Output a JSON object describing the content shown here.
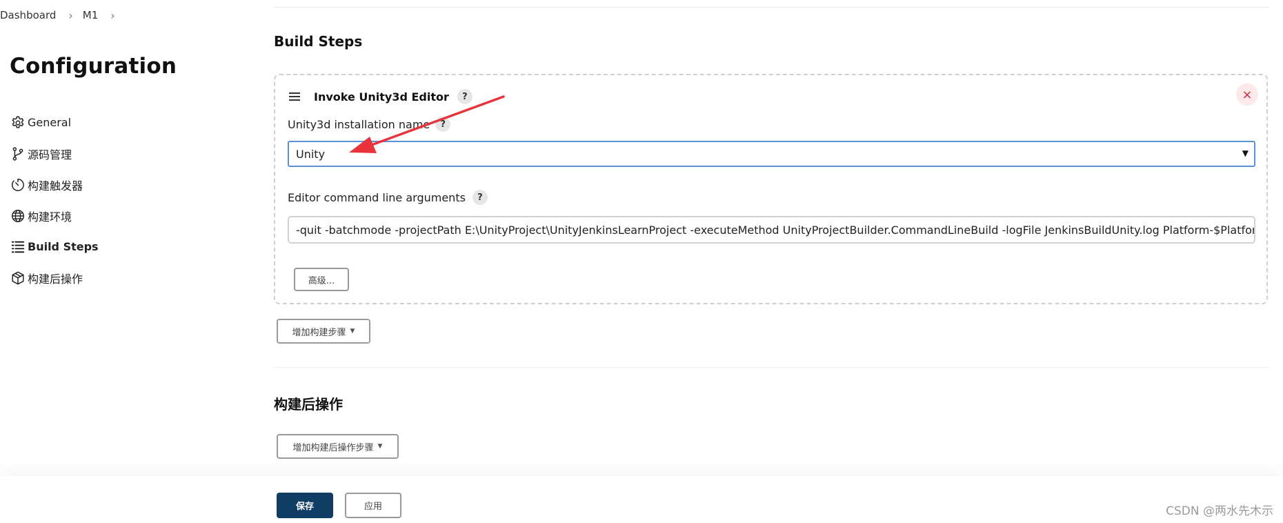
{
  "breadcrumb": {
    "items": [
      "Dashboard",
      "M1"
    ]
  },
  "page": {
    "title": "Configuration"
  },
  "sidebar": {
    "items": [
      {
        "label": "General",
        "icon": "gear-icon",
        "active": false
      },
      {
        "label": "源码管理",
        "icon": "git-branch-icon",
        "active": false
      },
      {
        "label": "构建触发器",
        "icon": "timer-icon",
        "active": false
      },
      {
        "label": "构建环境",
        "icon": "globe-icon",
        "active": false
      },
      {
        "label": "Build Steps",
        "icon": "list-icon",
        "active": true
      },
      {
        "label": "构建后操作",
        "icon": "package-icon",
        "active": false
      }
    ]
  },
  "build_steps": {
    "title": "Build Steps",
    "step": {
      "title": "Invoke Unity3d Editor",
      "help": "?",
      "close": "×",
      "installation_label": "Unity3d installation name",
      "installation_value": "Unity",
      "args_label": "Editor command line arguments",
      "args_value": "-quit -batchmode -projectPath E:\\UnityProject\\UnityJenkinsLearnProject -executeMethod UnityProjectBuilder.CommandLineBuild -logFile JenkinsBuildUnity.log Platform-$Platform Buil",
      "advanced_label": "高级..."
    },
    "add_step_label": "增加构建步骤"
  },
  "post_build": {
    "title": "构建后操作",
    "add_label": "增加构建后操作步骤"
  },
  "footer": {
    "save_label": "保存",
    "apply_label": "应用"
  },
  "watermark": "CSDN @两水先木示",
  "colors": {
    "save_button": "#0f3d63",
    "close_button_bg": "#fde8eb",
    "close_button_fg": "#d22b3b",
    "select_border": "#5b8fd6",
    "annotation_arrow": "#e8333c"
  }
}
